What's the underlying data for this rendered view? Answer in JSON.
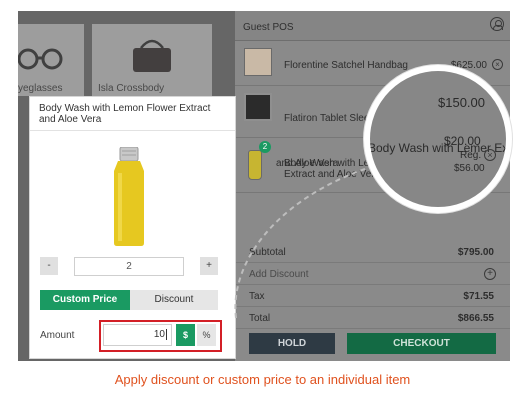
{
  "catalog": {
    "tiles": [
      {
        "label": "yeglasses",
        "icon": "eyeglasses-icon"
      },
      {
        "label": "Isla Crossbody",
        "icon": "handbag-icon"
      }
    ]
  },
  "cart": {
    "title": "Guest POS",
    "items": [
      {
        "name": "Florentine Satchel Handbag",
        "price": "$625.00"
      },
      {
        "name": "Flatiron Tablet Sleeve"
      },
      {
        "name": "Body Wash with Lemon Flower Extract and Aloe Vera",
        "qty_badge": "2"
      }
    ],
    "remove_icon": "×",
    "summary": {
      "subtotal_label": "Subtotal",
      "subtotal_value": "$795.00",
      "add_discount_label": "Add Discount",
      "add_icon": "+",
      "tax_label": "Tax",
      "tax_value": "$71.55",
      "total_label": "Total",
      "total_value": "$866.55"
    },
    "hold_label": "HOLD",
    "checkout_label": "CHECKOUT"
  },
  "popup": {
    "title": "Body Wash with Lemon Flower Extract and Aloe Vera",
    "qty_minus": "-",
    "qty_value": "2",
    "qty_plus": "+",
    "tab_custom_price": "Custom Price",
    "tab_discount": "Discount",
    "amount_label": "Amount",
    "amount_value": "10",
    "unit_dollar": "$",
    "unit_percent": "%"
  },
  "magnifier": {
    "price_top": "$150.00",
    "item_name": "Body Wash with Lemer Extract",
    "item_name_line2": "and Aloe Vera",
    "price": "$20.00",
    "reg_label": "Reg.",
    "reg_price": "$56.00"
  },
  "caption": "Apply discount or custom price to an individual item",
  "colors": {
    "accent_green": "#1a9a62",
    "highlight_red": "#d31f26",
    "caption_orange": "#e0521f"
  }
}
